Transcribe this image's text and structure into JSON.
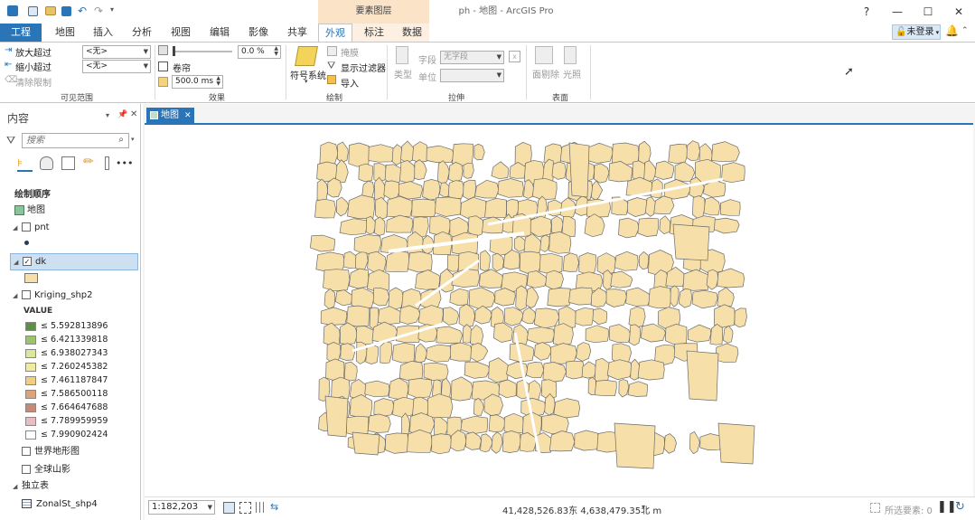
{
  "quick_access": {
    "undo_icon": "undo-icon",
    "redo_icon": "redo-icon"
  },
  "title_bar": {
    "context_group": "要素图层",
    "window_title": "ph - 地图 - ArcGIS Pro",
    "help": "?",
    "minimize": "—",
    "maximize": "☐",
    "close": "✕"
  },
  "tabs": [
    "工程",
    "地图",
    "插入",
    "分析",
    "视图",
    "编辑",
    "影像",
    "共享",
    "外观",
    "标注",
    "数据"
  ],
  "active_tab": "外观",
  "user": {
    "label": "未登录"
  },
  "ribbon": {
    "visible_range": {
      "zoom_in_beyond": "放大超过",
      "zoom_out_beyond": "缩小超过",
      "clear_limits": "清除限制",
      "in_value": "<无>",
      "out_value": "<无>",
      "label": "可见范围"
    },
    "effects": {
      "transparency": "0.0 %",
      "swipe": "卷帘",
      "flicker": "500.0",
      "flicker_unit": "ms",
      "label": "效果"
    },
    "drawing": {
      "symbology": "符号系统",
      "mask": "掩膜",
      "display_filters": "显示过滤器",
      "import": "导入",
      "label": "绘制"
    },
    "extrusion": {
      "type": "类型",
      "field": "字段",
      "field_value": "无字段",
      "unit": "单位",
      "label": "拉伸"
    },
    "faces": {
      "face_culling": "面剔除",
      "lighting": "光照",
      "label": "表面"
    }
  },
  "toc": {
    "title": "内容",
    "search_placeholder": "搜索",
    "drawing_order": "绘制顺序",
    "items": [
      {
        "name": "地图"
      },
      {
        "name": "pnt"
      },
      {
        "name": "dk"
      },
      {
        "name": "Kriging_shp2"
      }
    ],
    "kriging_field": "VALUE",
    "legend": [
      {
        "label": "≤ 5.592813896",
        "color": "#5e8f47"
      },
      {
        "label": "≤ 6.421339818",
        "color": "#9cc46a"
      },
      {
        "label": "≤ 6.938027343",
        "color": "#d9e89b"
      },
      {
        "label": "≤ 7.260245382",
        "color": "#f3ea9c"
      },
      {
        "label": "≤ 7.461187847",
        "color": "#f2cf7f"
      },
      {
        "label": "≤ 7.586500118",
        "color": "#dba47c"
      },
      {
        "label": "≤ 7.664647688",
        "color": "#c68a76"
      },
      {
        "label": "≤ 7.789959959",
        "color": "#e9bcc4"
      },
      {
        "label": "≤ 7.990902424",
        "color": "#ffffff"
      }
    ],
    "basemaps": [
      "世界地形图",
      "全球山影"
    ],
    "standalone_tables": "独立表",
    "table_name": "ZonalSt_shp4"
  },
  "map": {
    "tab_label": "地图",
    "parcel_fill": "#f7dfa9",
    "scale": "1:182,203",
    "coordinates": "41,428,526.83东 4,638,479.35北 m",
    "selected_features": "所选要素: 0"
  }
}
